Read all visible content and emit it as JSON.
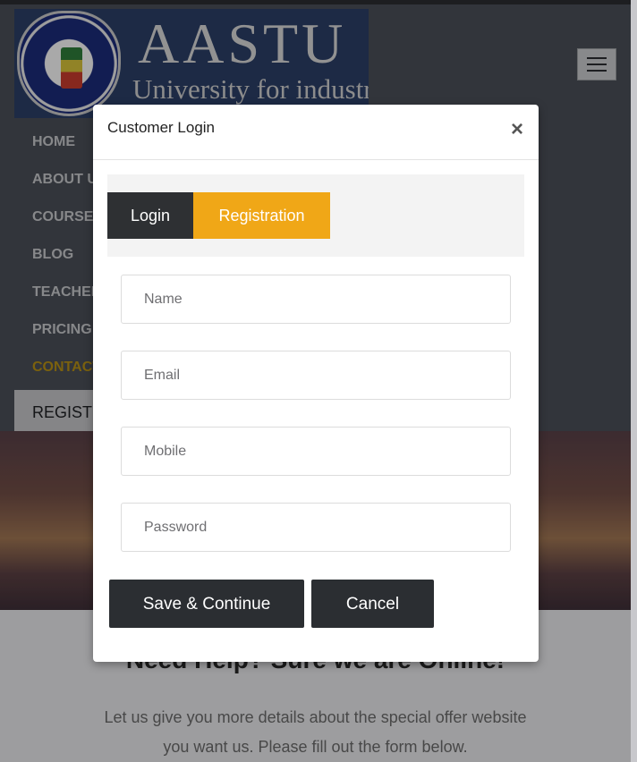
{
  "logo": {
    "title": "AASTU",
    "subtitle": "University for industry"
  },
  "nav": {
    "items": [
      {
        "label": "HOME"
      },
      {
        "label": "ABOUT US"
      },
      {
        "label": "COURSES"
      },
      {
        "label": "BLOG"
      },
      {
        "label": "TEACHERS"
      },
      {
        "label": "PRICING"
      },
      {
        "label": "CONTACT"
      }
    ],
    "register_label": "REGISTER",
    "active_item": "CONTACT",
    "menu_icon": "hamburger-icon"
  },
  "section": {
    "heading": "Need Help? Sure we are Online!",
    "text": "Let us give you more details about the special offer website you want us. Please fill out the form below."
  },
  "modal": {
    "title": "Customer Login",
    "close_label": "×",
    "tabs": {
      "login": "Login",
      "registration": "Registration",
      "active": "Registration"
    },
    "fields": {
      "name_placeholder": "Name",
      "email_placeholder": "Email",
      "mobile_placeholder": "Mobile",
      "password_placeholder": "Password"
    },
    "buttons": {
      "save": "Save & Continue",
      "cancel": "Cancel"
    }
  },
  "colors": {
    "accent": "#f0a717",
    "dark": "#2e3033",
    "header_bg": "#4a4e57"
  }
}
